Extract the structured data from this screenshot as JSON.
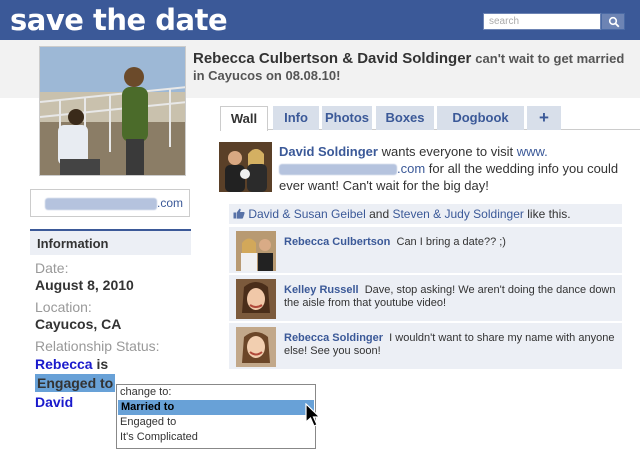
{
  "app": {
    "brand": "save the date"
  },
  "search": {
    "placeholder": "search"
  },
  "profile": {
    "name": "Rebecca Culbertson & David Soldinger",
    "status": "can't wait to get married in Cayucos on 08.08.10!"
  },
  "tabs": [
    {
      "label": "Wall",
      "active": true
    },
    {
      "label": "Info"
    },
    {
      "label": "Photos"
    },
    {
      "label": "Boxes"
    },
    {
      "label": "Dogbook"
    },
    {
      "label": "+"
    }
  ],
  "url_box": {
    "suffix": ".com"
  },
  "info": {
    "heading": "Information",
    "date_label": "Date:",
    "date_value": "August 8, 2010",
    "location_label": "Location:",
    "location_value": "Cayucos, CA",
    "relationship_label": "Relationship Status:",
    "rel_name1": "Rebecca",
    "rel_is": " is",
    "rel_status": "Engaged to",
    "rel_name2": "David"
  },
  "dropdown": {
    "header": "change to:",
    "options": [
      "Married to",
      "Engaged to",
      "It's Complicated"
    ],
    "selected": "Married to"
  },
  "post": {
    "author": "David Soldinger",
    "text_before_link": "wants everyone to visit",
    "link_prefix": "www.",
    "link_suffix": ".com",
    "text_after_link": "for all the wedding info you could ever want! Can't wait for the big day!"
  },
  "likes": {
    "person1": "David & Susan Geibel",
    "and": "and",
    "person2": "Steven & Judy Soldinger",
    "suffix": "like this."
  },
  "comments": [
    {
      "author": "Rebecca Culbertson",
      "text": "Can I bring a date?? ;)"
    },
    {
      "author": "Kelley Russell",
      "text": "Dave, stop asking! We aren't doing the dance down the aisle from that youtube video!"
    },
    {
      "author": "Rebecca Soldinger",
      "text": "I wouldn't want to share my name with anyone else! See you soon!"
    }
  ],
  "colors": {
    "brand_blue": "#3b5998",
    "tab_bg": "#d8dfea",
    "panel_bg": "#eceff5",
    "highlight": "#68a1d7"
  }
}
